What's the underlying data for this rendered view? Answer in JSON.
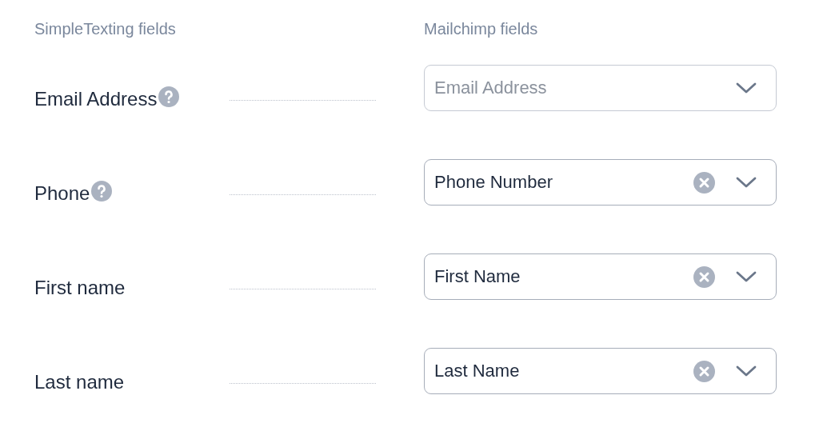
{
  "headers": {
    "left": "SimpleTexting fields",
    "right": "Mailchimp fields"
  },
  "rows": [
    {
      "label": "Email Address",
      "help": true,
      "placeholder": "Email Address"
    },
    {
      "label": "Phone",
      "help": true,
      "value": "Phone Number"
    },
    {
      "label": "First name",
      "help": false,
      "value": "First Name"
    },
    {
      "label": "Last name",
      "help": false,
      "value": "Last Name"
    }
  ]
}
